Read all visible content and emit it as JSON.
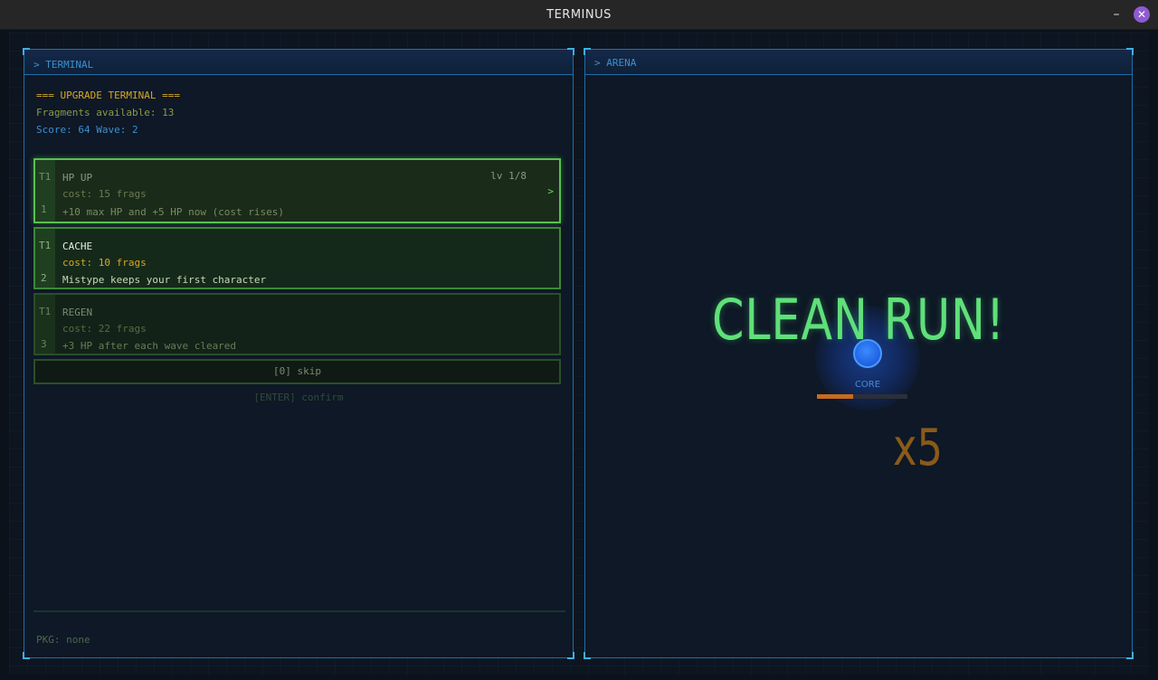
{
  "window": {
    "title": "TERMINUS",
    "minimize": "–",
    "close": "✕"
  },
  "terminal": {
    "panel_label": "> TERMINAL",
    "header": "=== UPGRADE TERMINAL ===",
    "fragments": "Fragments available:  13",
    "score_wave": "Score:  64   Wave:  2",
    "upgrades": [
      {
        "tier": "T1",
        "key": "1",
        "name": "HP UP",
        "level": "lv 1/8",
        "cost": "cost: 15 frags",
        "desc": "+10 max HP and +5 HP now  (cost rises)",
        "selected_marker": ">"
      },
      {
        "tier": "T1",
        "key": "2",
        "name": "CACHE",
        "cost": "cost: 10 frags",
        "desc": "Mistype keeps your first character"
      },
      {
        "tier": "T1",
        "key": "3",
        "name": "REGEN",
        "cost": "cost: 22 frags",
        "desc": "+3 HP after each wave cleared"
      }
    ],
    "skip": "[0]  skip",
    "confirm": "[ENTER] confirm",
    "pkg": "PKG: none"
  },
  "arena": {
    "panel_label": "> ARENA",
    "banner": "CLEAN RUN!",
    "core_label": "CORE",
    "core_hp_fraction": 0.4,
    "multiplier": "x5"
  },
  "colors": {
    "accent_blue": "#1f6fa8",
    "banner_green": "#5fe07a",
    "gold": "#d6a825",
    "core_blue": "#1f5fe0",
    "hp_orange": "#c86a20"
  }
}
